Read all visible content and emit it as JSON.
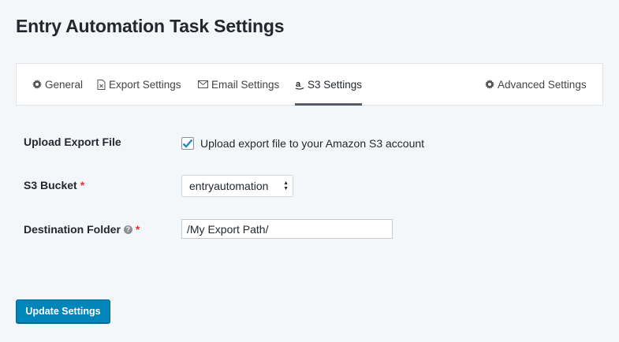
{
  "page": {
    "title": "Entry Automation Task Settings"
  },
  "tabs": [
    {
      "label": "General",
      "icon": "gear-icon"
    },
    {
      "label": "Export Settings",
      "icon": "file-icon"
    },
    {
      "label": "Email Settings",
      "icon": "envelope-icon"
    },
    {
      "label": "S3 Settings",
      "icon": "amazon-icon",
      "active": true
    },
    {
      "label": "Advanced Settings",
      "icon": "gear-icon"
    }
  ],
  "upload": {
    "label": "Upload Export File",
    "checkbox_label": "Upload export file to your Amazon S3 account",
    "checked": true
  },
  "bucket": {
    "label": "S3 Bucket",
    "required_mark": "*",
    "selected": "entryautomation"
  },
  "destination": {
    "label": "Destination Folder",
    "required_mark": "*",
    "help_glyph": "?",
    "value": "/My Export Path/"
  },
  "actions": {
    "update_label": "Update Settings"
  },
  "colors": {
    "accent": "#0085ba",
    "required": "#dc3232",
    "checkbox_check": "#1e8cbe"
  }
}
